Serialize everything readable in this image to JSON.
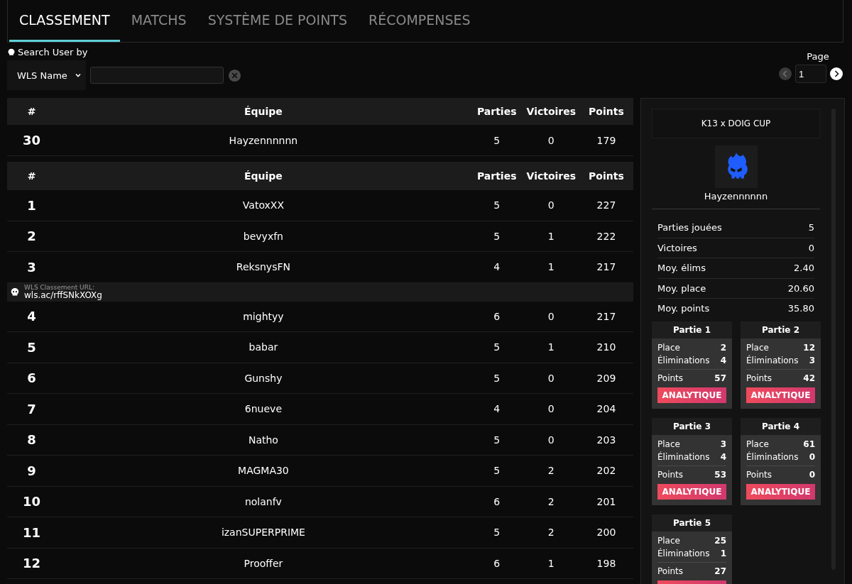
{
  "tabs": [
    {
      "label": "CLASSEMENT",
      "selected": true
    },
    {
      "label": "MATCHS",
      "selected": false
    },
    {
      "label": "SYSTÈME DE POINTS",
      "selected": false
    },
    {
      "label": "RÉCOMPENSES",
      "selected": false
    }
  ],
  "search": {
    "label": "Search User by",
    "mode": "WLS Name"
  },
  "pager": {
    "label": "Page",
    "value": "1",
    "prev_disabled": true
  },
  "columns": [
    "#",
    "Équipe",
    "Parties",
    "Victoires",
    "Points"
  ],
  "columns_2": [
    "#",
    "Équipe",
    "Parties",
    "Victoires",
    "Points"
  ],
  "user_row": {
    "rank": "30",
    "team": "Hayzennnnnn",
    "games": "5",
    "wins": "0",
    "points": "179"
  },
  "rows": [
    {
      "kind": "team",
      "rank": "1",
      "team": "VatoxXX",
      "games": "5",
      "wins": "0",
      "points": "227"
    },
    {
      "kind": "team",
      "rank": "2",
      "team": "bevyxfn",
      "games": "5",
      "wins": "1",
      "points": "222"
    },
    {
      "kind": "team",
      "rank": "3",
      "team": "ReksnysFN",
      "games": "4",
      "wins": "1",
      "points": "217"
    },
    {
      "kind": "banner",
      "caption": "WLS Classement URL:",
      "url": "wls.ac/rffSNkXOXg"
    },
    {
      "kind": "team",
      "rank": "4",
      "team": "mightyy",
      "games": "6",
      "wins": "0",
      "points": "217"
    },
    {
      "kind": "team",
      "rank": "5",
      "team": "babar",
      "games": "5",
      "wins": "1",
      "points": "210"
    },
    {
      "kind": "team",
      "rank": "6",
      "team": "Gunshy",
      "games": "5",
      "wins": "0",
      "points": "209"
    },
    {
      "kind": "team",
      "rank": "7",
      "team": "6nueve",
      "games": "4",
      "wins": "0",
      "points": "204"
    },
    {
      "kind": "team",
      "rank": "8",
      "team": "Natho",
      "games": "5",
      "wins": "0",
      "points": "203"
    },
    {
      "kind": "team",
      "rank": "9",
      "team": "MAGMA30",
      "games": "5",
      "wins": "2",
      "points": "202"
    },
    {
      "kind": "team",
      "rank": "10",
      "team": "nolanfv",
      "games": "6",
      "wins": "2",
      "points": "201"
    },
    {
      "kind": "team",
      "rank": "11",
      "team": "izanSUPERPRIME",
      "games": "5",
      "wins": "2",
      "points": "200"
    },
    {
      "kind": "team",
      "rank": "12",
      "team": "Prooffer",
      "games": "6",
      "wins": "1",
      "points": "198"
    }
  ],
  "panel": {
    "event": "K13 x DOIG CUP",
    "player": "Hayzennnnnn",
    "stats": [
      {
        "label": "Parties jouées",
        "value": "5"
      },
      {
        "label": "Victoires",
        "value": "0"
      },
      {
        "label": "Moy. élims",
        "value": "2.40"
      },
      {
        "label": "Moy. place",
        "value": "20.60"
      },
      {
        "label": "Moy. points",
        "value": "35.80"
      }
    ],
    "games": [
      {
        "title": "Partie 1",
        "place_label": "Place",
        "place": "2",
        "elims_label": "Éliminations",
        "elims": "4",
        "points_label": "Points",
        "points": "57",
        "button": "ANALYTIQUE"
      },
      {
        "title": "Partie 2",
        "place_label": "Place",
        "place": "12",
        "elims_label": "Éliminations",
        "elims": "3",
        "points_label": "Points",
        "points": "42",
        "button": "ANALYTIQUE"
      },
      {
        "title": "Partie 3",
        "place_label": "Place",
        "place": "3",
        "elims_label": "Éliminations",
        "elims": "4",
        "points_label": "Points",
        "points": "53",
        "button": "ANALYTIQUE"
      },
      {
        "title": "Partie 4",
        "place_label": "Place",
        "place": "61",
        "elims_label": "Éliminations",
        "elims": "0",
        "points_label": "Points",
        "points": "0",
        "button": "ANALYTIQUE"
      },
      {
        "title": "Partie 5",
        "place_label": "Place",
        "place": "25",
        "elims_label": "Éliminations",
        "elims": "1",
        "points_label": "Points",
        "points": "27"
      }
    ]
  }
}
